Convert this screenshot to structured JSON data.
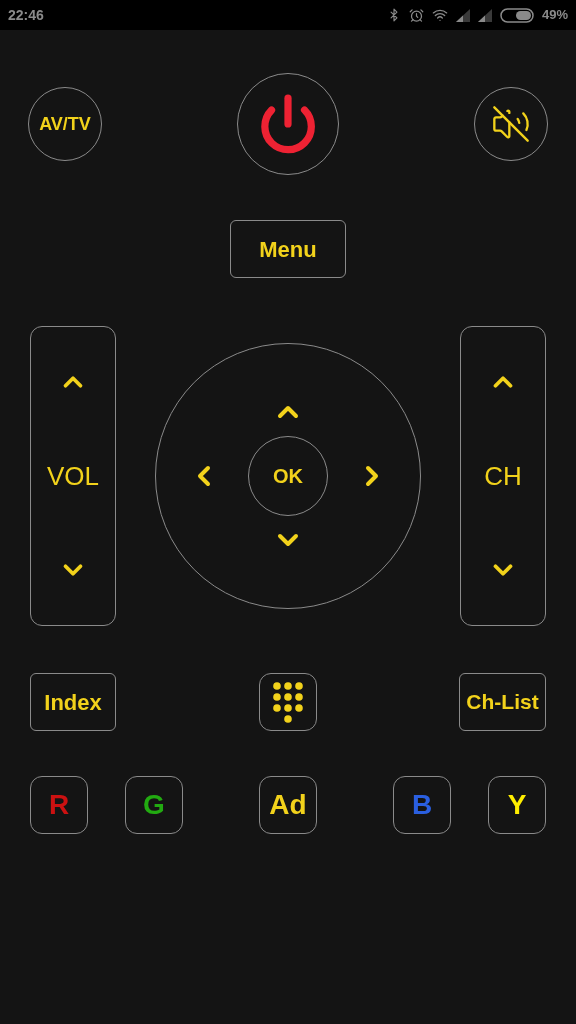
{
  "status_bar": {
    "time": "22:46",
    "battery": "49%"
  },
  "top_row": {
    "av_tv": "AV/TV"
  },
  "menu": "Menu",
  "volume": {
    "label": "VOL"
  },
  "dpad": {
    "ok": "OK"
  },
  "channel": {
    "label": "CH"
  },
  "index": "Index",
  "ch_list": "Ch-List",
  "color_buttons": [
    {
      "label": "R",
      "color": "#cc1111"
    },
    {
      "label": "G",
      "color": "#22aa11"
    },
    {
      "label": "Ad",
      "color": "#f2d21b"
    },
    {
      "label": "B",
      "color": "#2a5fe0"
    },
    {
      "label": "Y",
      "color": "#ffee00"
    }
  ]
}
